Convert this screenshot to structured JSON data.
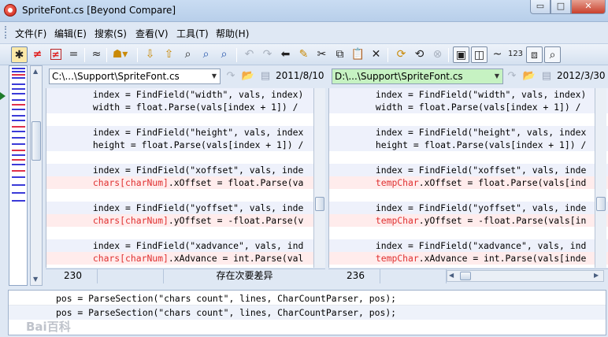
{
  "window": {
    "title": "SpriteFont.cs  [Beyond Compare]",
    "min_label": "▭",
    "max_label": "□",
    "close_label": "✕"
  },
  "menu": [
    "文件(F)",
    "编辑(E)",
    "搜索(S)",
    "查看(V)",
    "工具(T)",
    "帮助(H)"
  ],
  "toolbar": {
    "icons": [
      "show-all-icon",
      "show-diffs-icon",
      "show-diffs-context-icon",
      "show-same-icon",
      "minor-diffs-icon",
      "rules-icon",
      "next-diff-icon",
      "prev-diff-icon",
      "find-icon",
      "find-next-icon",
      "find-prev-icon",
      "undo-icon",
      "redo-icon",
      "copy-to-left-icon",
      "edit-icon",
      "cut-icon",
      "copy-icon",
      "paste-icon",
      "delete-icon",
      "swap-sides-icon",
      "refresh-icon",
      "stop-icon",
      "layout-icon",
      "columns-icon",
      "whitespace-icon",
      "line-numbers-icon",
      "split-icon",
      "zoom-icon"
    ],
    "line_numbers_label": "123",
    "tilde_label": "~"
  },
  "left_pane": {
    "path": "C:\\...\\Support\\SpriteFont.cs",
    "date": "2011/8/10",
    "line_number": "230",
    "status": "存在次要差异",
    "lines": [
      {
        "text": "        index = FindField(\"width\", vals, index)",
        "diff": false
      },
      {
        "text": "        width = float.Parse(vals[index + 1]) /",
        "diff": false
      },
      {
        "text": "",
        "diff": false
      },
      {
        "text": "        index = FindField(\"height\", vals, index",
        "diff": false
      },
      {
        "text": "        height = float.Parse(vals[index + 1]) /",
        "diff": false
      },
      {
        "text": "",
        "diff": false
      },
      {
        "text": "        index = FindField(\"xoffset\", vals, inde",
        "diff": false
      },
      {
        "pre": "        ",
        "hl": "chars[charNum]",
        "post": ".xOffset = float.Parse(va",
        "diff": true
      },
      {
        "text": "",
        "diff": false
      },
      {
        "text": "        index = FindField(\"yoffset\", vals, inde",
        "diff": false
      },
      {
        "pre": "        ",
        "hl": "chars[charNum]",
        "post": ".yOffset = -float.Parse(v",
        "diff": true
      },
      {
        "text": "",
        "diff": false
      },
      {
        "text": "        index = FindField(\"xadvance\", vals, ind",
        "diff": false
      },
      {
        "pre": "        ",
        "hl": "chars[charNum]",
        "post": ".xAdvance = int.Parse(val",
        "diff": true
      }
    ]
  },
  "right_pane": {
    "path": "D:\\...\\Support\\SpriteFont.cs",
    "date": "2012/3/30",
    "line_number": "236",
    "lines": [
      {
        "text": "        index = FindField(\"width\", vals, index)",
        "diff": false
      },
      {
        "text": "        width = float.Parse(vals[index + 1]) /",
        "diff": false
      },
      {
        "text": "",
        "diff": false
      },
      {
        "text": "        index = FindField(\"height\", vals, index",
        "diff": false
      },
      {
        "text": "        height = float.Parse(vals[index + 1]) /",
        "diff": false
      },
      {
        "text": "",
        "diff": false
      },
      {
        "text": "        index = FindField(\"xoffset\", vals, inde",
        "diff": false
      },
      {
        "pre": "        ",
        "hl": "tempChar",
        "post": ".xOffset = float.Parse(vals[ind",
        "diff": true
      },
      {
        "text": "",
        "diff": false
      },
      {
        "text": "        index = FindField(\"yoffset\", vals, inde",
        "diff": false
      },
      {
        "pre": "        ",
        "hl": "tempChar",
        "post": ".yOffset = -float.Parse(vals[in",
        "diff": true
      },
      {
        "text": "",
        "diff": false
      },
      {
        "text": "        index = FindField(\"xadvance\", vals, ind",
        "diff": false
      },
      {
        "pre": "        ",
        "hl": "tempChar",
        "post": ".xAdvance = int.Parse(vals[inde",
        "diff": true
      }
    ]
  },
  "bottom_compare": {
    "line1": "pos = ParseSection(\"chars count\", lines, CharCountParser, pos);",
    "line2": "pos = ParseSection(\"chars count\", lines, CharCountParser, pos);"
  },
  "watermark": "Bai百科",
  "colors": {
    "diff_line_bg": "#ffecec",
    "diff_text": "#e03030",
    "changed_path_bg": "#c6f2c2",
    "context_line_bg": "#eef1fb",
    "overview_diff": "#e0314a",
    "overview_block": "#3a3ad8"
  }
}
